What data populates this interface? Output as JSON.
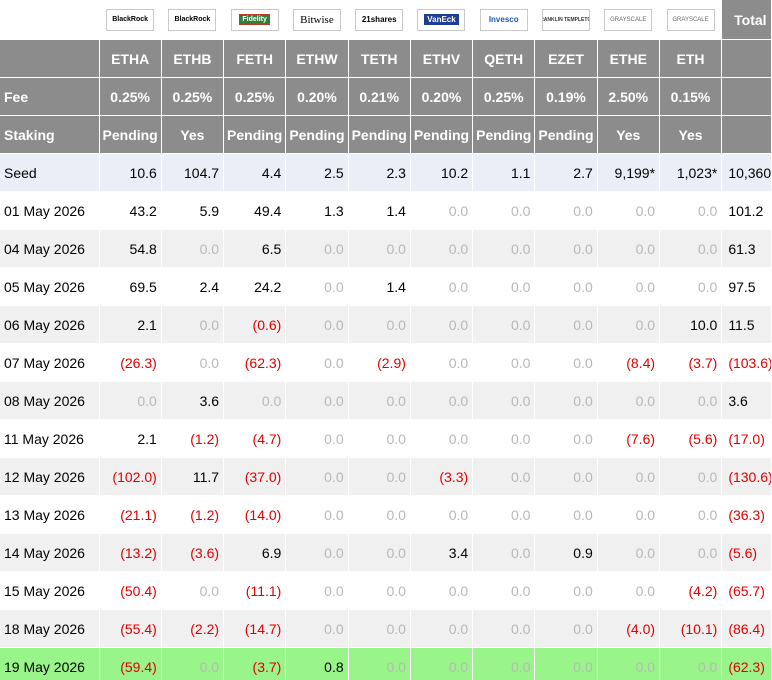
{
  "header": {
    "total_label": "Total",
    "tickers": [
      "ETHA",
      "ETHB",
      "FETH",
      "ETHW",
      "TETH",
      "ETHV",
      "QETH",
      "EZET",
      "ETHE",
      "ETH"
    ],
    "issuer_logos": [
      {
        "name": "BlackRock",
        "icon": "blackrock-logo"
      },
      {
        "name": "BlackRock",
        "icon": "blackrock-logo"
      },
      {
        "name": "Fidelity",
        "icon": "fidelity-logo"
      },
      {
        "name": "Bitwise",
        "icon": "bitwise-logo"
      },
      {
        "name": "21shares",
        "icon": "21shares-logo"
      },
      {
        "name": "VanEck",
        "icon": "vaneck-logo"
      },
      {
        "name": "Invesco",
        "icon": "invesco-logo"
      },
      {
        "name": "FRANKLIN TEMPLETON",
        "icon": "franklin-templeton-logo"
      },
      {
        "name": "GRAYSCALE",
        "icon": "grayscale-logo"
      },
      {
        "name": "GRAYSCALE",
        "icon": "grayscale-logo"
      }
    ],
    "fee_label": "Fee",
    "fees": [
      "0.25%",
      "0.25%",
      "0.25%",
      "0.20%",
      "0.21%",
      "0.20%",
      "0.25%",
      "0.19%",
      "2.50%",
      "0.15%"
    ],
    "staking_label": "Staking",
    "staking": [
      "Pending",
      "Yes",
      "Pending",
      "Pending",
      "Pending",
      "Pending",
      "Pending",
      "Pending",
      "Yes",
      "Yes"
    ]
  },
  "rows": [
    {
      "label": "Seed",
      "kind": "seed",
      "values": [
        "10.6",
        "104.7",
        "4.4",
        "2.5",
        "2.3",
        "10.2",
        "1.1",
        "2.7",
        "9,199*",
        "1,023*"
      ],
      "total": "10,360"
    },
    {
      "label": "01 May 2026",
      "kind": "odd",
      "values": [
        "43.2",
        "5.9",
        "49.4",
        "1.3",
        "1.4",
        "0.0",
        "0.0",
        "0.0",
        "0.0",
        "0.0"
      ],
      "total": "101.2"
    },
    {
      "label": "04 May 2026",
      "kind": "even",
      "values": [
        "54.8",
        "0.0",
        "6.5",
        "0.0",
        "0.0",
        "0.0",
        "0.0",
        "0.0",
        "0.0",
        "0.0"
      ],
      "total": "61.3"
    },
    {
      "label": "05 May 2026",
      "kind": "odd",
      "values": [
        "69.5",
        "2.4",
        "24.2",
        "0.0",
        "1.4",
        "0.0",
        "0.0",
        "0.0",
        "0.0",
        "0.0"
      ],
      "total": "97.5"
    },
    {
      "label": "06 May 2026",
      "kind": "even",
      "values": [
        "2.1",
        "0.0",
        "(0.6)",
        "0.0",
        "0.0",
        "0.0",
        "0.0",
        "0.0",
        "0.0",
        "10.0"
      ],
      "total": "11.5"
    },
    {
      "label": "07 May 2026",
      "kind": "odd",
      "values": [
        "(26.3)",
        "0.0",
        "(62.3)",
        "0.0",
        "(2.9)",
        "0.0",
        "0.0",
        "0.0",
        "(8.4)",
        "(3.7)"
      ],
      "total": "(103.6)"
    },
    {
      "label": "08 May 2026",
      "kind": "even",
      "values": [
        "0.0",
        "3.6",
        "0.0",
        "0.0",
        "0.0",
        "0.0",
        "0.0",
        "0.0",
        "0.0",
        "0.0"
      ],
      "total": "3.6"
    },
    {
      "label": "11 May 2026",
      "kind": "odd",
      "values": [
        "2.1",
        "(1.2)",
        "(4.7)",
        "0.0",
        "0.0",
        "0.0",
        "0.0",
        "0.0",
        "(7.6)",
        "(5.6)"
      ],
      "total": "(17.0)"
    },
    {
      "label": "12 May 2026",
      "kind": "even",
      "values": [
        "(102.0)",
        "11.7",
        "(37.0)",
        "0.0",
        "0.0",
        "(3.3)",
        "0.0",
        "0.0",
        "0.0",
        "0.0"
      ],
      "total": "(130.6)"
    },
    {
      "label": "13 May 2026",
      "kind": "odd",
      "values": [
        "(21.1)",
        "(1.2)",
        "(14.0)",
        "0.0",
        "0.0",
        "0.0",
        "0.0",
        "0.0",
        "0.0",
        "0.0"
      ],
      "total": "(36.3)"
    },
    {
      "label": "14 May 2026",
      "kind": "even",
      "values": [
        "(13.2)",
        "(3.6)",
        "6.9",
        "0.0",
        "0.0",
        "3.4",
        "0.0",
        "0.9",
        "0.0",
        "0.0"
      ],
      "total": "(5.6)"
    },
    {
      "label": "15 May 2026",
      "kind": "odd",
      "values": [
        "(50.4)",
        "0.0",
        "(11.1)",
        "0.0",
        "0.0",
        "0.0",
        "0.0",
        "0.0",
        "0.0",
        "(4.2)"
      ],
      "total": "(65.7)"
    },
    {
      "label": "18 May 2026",
      "kind": "even",
      "values": [
        "(55.4)",
        "(2.2)",
        "(14.7)",
        "0.0",
        "0.0",
        "0.0",
        "0.0",
        "0.0",
        "(4.0)",
        "(10.1)"
      ],
      "total": "(86.4)"
    },
    {
      "label": "19 May 2026",
      "kind": "last",
      "values": [
        "(59.4)",
        "0.0",
        "(3.7)",
        "0.8",
        "0.0",
        "0.0",
        "0.0",
        "0.0",
        "0.0",
        "0.0"
      ],
      "total": "(62.3)"
    }
  ],
  "colors": {
    "header_bg": "#8c8c8c",
    "seed_bg": "#e9eef7",
    "alt_bg": "#f0f0f0",
    "highlight_bg": "#99f589",
    "negative": "#e00000",
    "zero": "#b8b8b8"
  }
}
